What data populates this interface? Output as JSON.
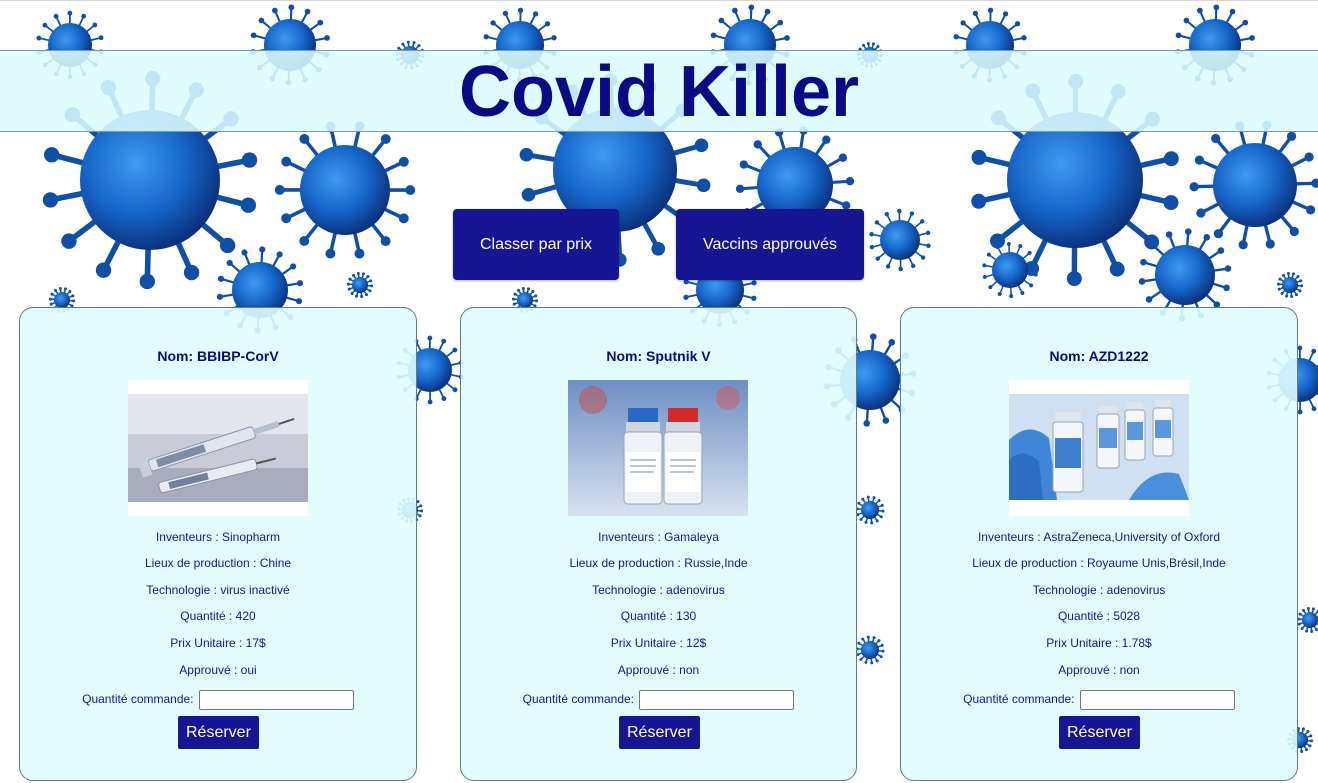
{
  "header": {
    "title": "Covid Killer"
  },
  "actions": {
    "sort_label": "Classer par prix",
    "approved_label": "Vaccins approuvés"
  },
  "labels": {
    "name": "Nom:",
    "inventors": "Inventeurs : ",
    "production": "Lieux de production : ",
    "technology": "Technologie : ",
    "quantity": "Quantité : ",
    "unit_price": "Prix Unitaire : ",
    "approved": "Approuvé : ",
    "order_quantity": "Quantité commande:",
    "reserve": "Réserver"
  },
  "vaccines": [
    {
      "name": "BBIBP-CorV",
      "image": "syringes-photo",
      "inventors": "Sinopharm",
      "production": "Chine",
      "technology": "virus inactivé",
      "quantity": "420",
      "unit_price": "17$",
      "approved": "oui",
      "order_value": ""
    },
    {
      "name": "Sputnik V",
      "image": "vaccine-vials-photo",
      "inventors": "Gamaleya",
      "production": "Russie,Inde",
      "technology": "adenovirus",
      "quantity": "130",
      "unit_price": "12$",
      "approved": "non",
      "order_value": ""
    },
    {
      "name": "AZD1222",
      "image": "gloved-hand-vials-photo",
      "inventors": "AstraZeneca,University of Oxford",
      "production": "Royaume Unis,Brésil,Inde",
      "technology": "adenovirus",
      "quantity": "5028",
      "unit_price": "1.78$",
      "approved": "non",
      "order_value": ""
    }
  ],
  "colors": {
    "primary": "#161594",
    "title": "#0b0a86",
    "card_bg": "#e0fdff",
    "virus": "#1a5fb4"
  }
}
